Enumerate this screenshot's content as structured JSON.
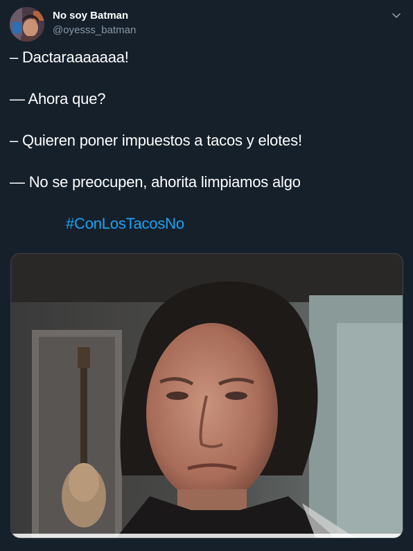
{
  "author": {
    "display_name": "No soy Batman",
    "handle": "@oyesss_batman",
    "avatar_icon": "profile-avatar-icon"
  },
  "menu_icon": "chevron-down-icon",
  "tweet": {
    "lines": [
      "– Dactaraaaaaaa!",
      "— Ahora que?",
      "– Quieren poner impuestos a tacos y elotes!",
      "— No se preocupen, ahorita limpiamos algo"
    ],
    "hashtag": "#ConLosTacosNo"
  },
  "colors": {
    "background": "#15202b",
    "text": "#ffffff",
    "secondary_text": "#8899a6",
    "link": "#1da1f2"
  }
}
